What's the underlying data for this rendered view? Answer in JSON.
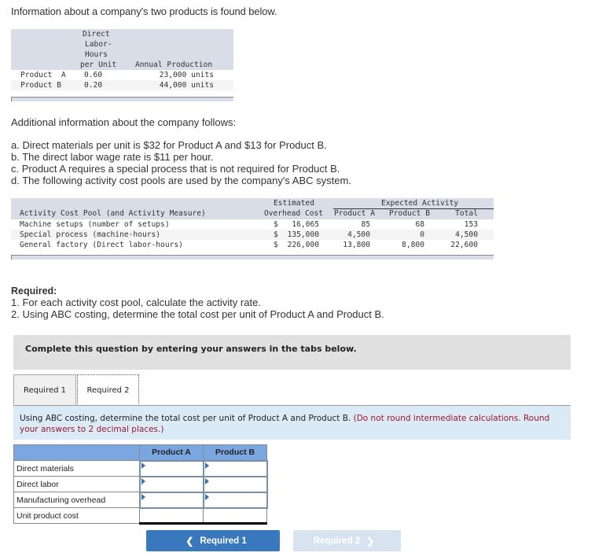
{
  "intro": "Information about a company's two products is found below.",
  "product_table": {
    "headers": {
      "labor_hours": [
        "Direct",
        "Labor-",
        "Hours",
        "per Unit"
      ],
      "annual_production": "Annual Production"
    },
    "rows": [
      {
        "product": "Product  A",
        "hours": "0.60",
        "production": "23,000 units"
      },
      {
        "product": "Product B",
        "hours": "0.20",
        "production": "44,000 units"
      }
    ]
  },
  "additional_title": "Additional information about the company follows:",
  "additional_items": [
    "a. Direct materials per unit is $32 for Product A and $13 for Product B.",
    "b. The direct labor wage rate is $11 per hour.",
    "c. Product A requires a special process that is not required for Product B.",
    "d. The following activity cost pools are used by the company's ABC system."
  ],
  "activity_table": {
    "headers": {
      "pool": "Activity Cost Pool (and Activity Measure)",
      "estimated_top": "Estimated",
      "estimated_bottom": "Overhead Cost",
      "expected_activity": "Expected Activity",
      "product_a": "Product A",
      "product_b": "Product B",
      "total": "Total"
    },
    "rows": [
      {
        "pool": "Machine setups (number of setups)",
        "dollar": "$",
        "cost": "16,065",
        "a": "85",
        "b": "68",
        "total": "153"
      },
      {
        "pool": "Special process (machine-hours)",
        "dollar": "$",
        "cost": "135,000",
        "a": "4,500",
        "b": "0",
        "total": "4,500"
      },
      {
        "pool": "General factory (Direct labor-hours)",
        "dollar": "$",
        "cost": "226,000",
        "a": "13,800",
        "b": "8,800",
        "total": "22,600"
      }
    ]
  },
  "required": {
    "title": "Required:",
    "items": [
      "1. For each activity cost pool, calculate the activity rate.",
      "2. Using ABC costing, determine the total cost per unit of Product A and Product B."
    ]
  },
  "complete_banner": "Complete this question by entering your answers in the tabs below.",
  "tabs": [
    {
      "label": "Required 1",
      "active": false
    },
    {
      "label": "Required 2",
      "active": true
    }
  ],
  "instruction": {
    "main": "Using ABC costing, determine the total cost per unit of Product A and Product B.",
    "note": "(Do not round intermediate calculations. Round your answers to 2 decimal places.)"
  },
  "answer_table": {
    "columns": [
      "Product A",
      "Product B"
    ],
    "rows": [
      {
        "label": "Direct materials",
        "a": "",
        "b": ""
      },
      {
        "label": "Direct labor",
        "a": "",
        "b": ""
      },
      {
        "label": "Manufacturing overhead",
        "a": "",
        "b": ""
      },
      {
        "label": "Unit product cost",
        "a": "",
        "b": ""
      }
    ]
  },
  "nav": {
    "prev_label": "Required 1",
    "next_label": "Required 2",
    "prev_icon": "chevron-left-icon",
    "next_icon": "chevron-right-icon"
  }
}
